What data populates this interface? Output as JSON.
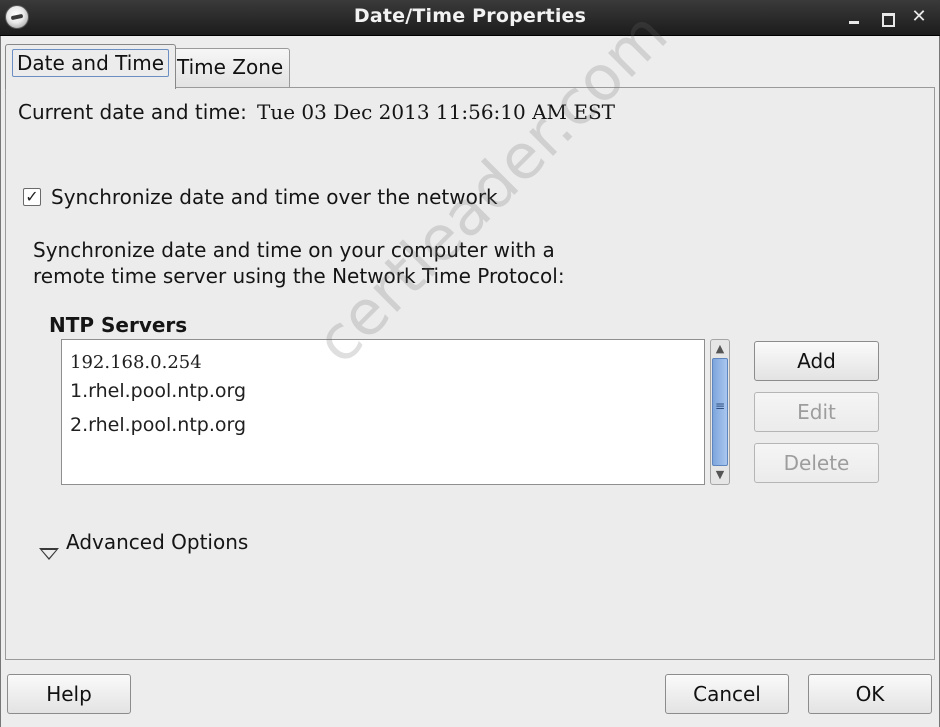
{
  "window": {
    "title": "Date/Time Properties",
    "close_glyph": "✕"
  },
  "tabs": [
    {
      "label": "Date and Time",
      "active": true
    },
    {
      "label": "Time Zone",
      "active": false
    }
  ],
  "date_time": {
    "current_label": "Current date and time:",
    "current_value": "Tue 03 Dec 2013 11:56:10 AM EST"
  },
  "sync": {
    "checked": true,
    "check_glyph": "✓",
    "label": "Synchronize date and time over the network",
    "description_line1": "Synchronize date and time on your computer with a",
    "description_line2": "remote time server using the Network Time Protocol:"
  },
  "ntp": {
    "heading": "NTP Servers",
    "servers": [
      "192.168.0.254",
      "1.rhel.pool.ntp.org",
      "2.rhel.pool.ntp.org"
    ],
    "buttons": {
      "add": "Add",
      "edit": "Edit",
      "delete": "Delete"
    }
  },
  "advanced": {
    "label": "Advanced Options"
  },
  "footer": {
    "help": "Help",
    "cancel": "Cancel",
    "ok": "OK"
  },
  "watermark": "certleader.com",
  "colors": {
    "scroll_thumb": "#7ea6dc",
    "titlebar": "#2a2a2a",
    "dialog_bg": "#ececec"
  }
}
